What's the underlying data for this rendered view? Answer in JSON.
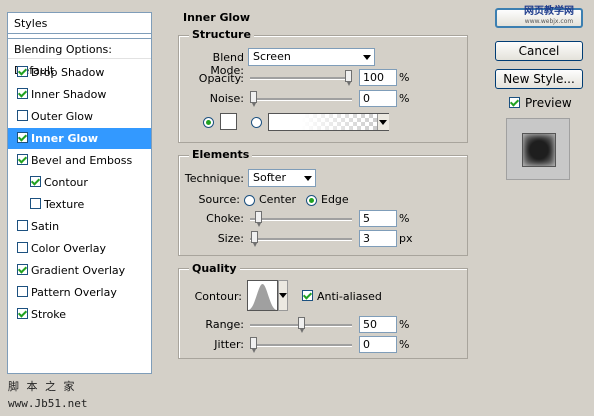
{
  "styles_panel": {
    "header": "Styles",
    "blending_options": "Blending Options: Default",
    "items": [
      {
        "label": "Drop Shadow",
        "checked": true,
        "selected": false,
        "indent": false
      },
      {
        "label": "Inner Shadow",
        "checked": true,
        "selected": false,
        "indent": false
      },
      {
        "label": "Outer Glow",
        "checked": false,
        "selected": false,
        "indent": false
      },
      {
        "label": "Inner Glow",
        "checked": true,
        "selected": true,
        "indent": false
      },
      {
        "label": "Bevel and Emboss",
        "checked": true,
        "selected": false,
        "indent": false
      },
      {
        "label": "Contour",
        "checked": true,
        "selected": false,
        "indent": true
      },
      {
        "label": "Texture",
        "checked": false,
        "selected": false,
        "indent": true
      },
      {
        "label": "Satin",
        "checked": false,
        "selected": false,
        "indent": false
      },
      {
        "label": "Color Overlay",
        "checked": false,
        "selected": false,
        "indent": false
      },
      {
        "label": "Gradient Overlay",
        "checked": true,
        "selected": false,
        "indent": false
      },
      {
        "label": "Pattern Overlay",
        "checked": false,
        "selected": false,
        "indent": false
      },
      {
        "label": "Stroke",
        "checked": true,
        "selected": false,
        "indent": false
      }
    ]
  },
  "inner_glow": {
    "title": "Inner Glow",
    "structure": {
      "title": "Structure",
      "blend_mode_label": "Blend Mode:",
      "blend_mode_value": "Screen",
      "opacity_label": "Opacity:",
      "opacity_value": "100",
      "opacity_unit": "%",
      "opacity_fraction": 1.0,
      "noise_label": "Noise:",
      "noise_value": "0",
      "noise_unit": "%",
      "noise_fraction": 0.0,
      "color_swatch": "#ffffff"
    },
    "elements": {
      "title": "Elements",
      "technique_label": "Technique:",
      "technique_value": "Softer",
      "source_label": "Source:",
      "source_center": "Center",
      "source_edge": "Edge",
      "choke_label": "Choke:",
      "choke_value": "5",
      "choke_unit": "%",
      "choke_fraction": 0.05,
      "size_label": "Size:",
      "size_value": "3",
      "size_unit": "px",
      "size_fraction": 0.012
    },
    "quality": {
      "title": "Quality",
      "contour_label": "Contour:",
      "anti_aliased_label": "Anti-aliased",
      "range_label": "Range:",
      "range_value": "50",
      "range_unit": "%",
      "range_fraction": 0.5,
      "jitter_label": "Jitter:",
      "jitter_value": "0",
      "jitter_unit": "%",
      "jitter_fraction": 0.0
    }
  },
  "buttons": {
    "cancel": "Cancel",
    "new_style": "New Style...",
    "preview": "Preview"
  },
  "watermark": {
    "top": "网页教学网",
    "top_sub": "www.webjx.com",
    "bottom_cn": "脚 本 之 家",
    "bottom_url": "www.Jb51.net"
  }
}
